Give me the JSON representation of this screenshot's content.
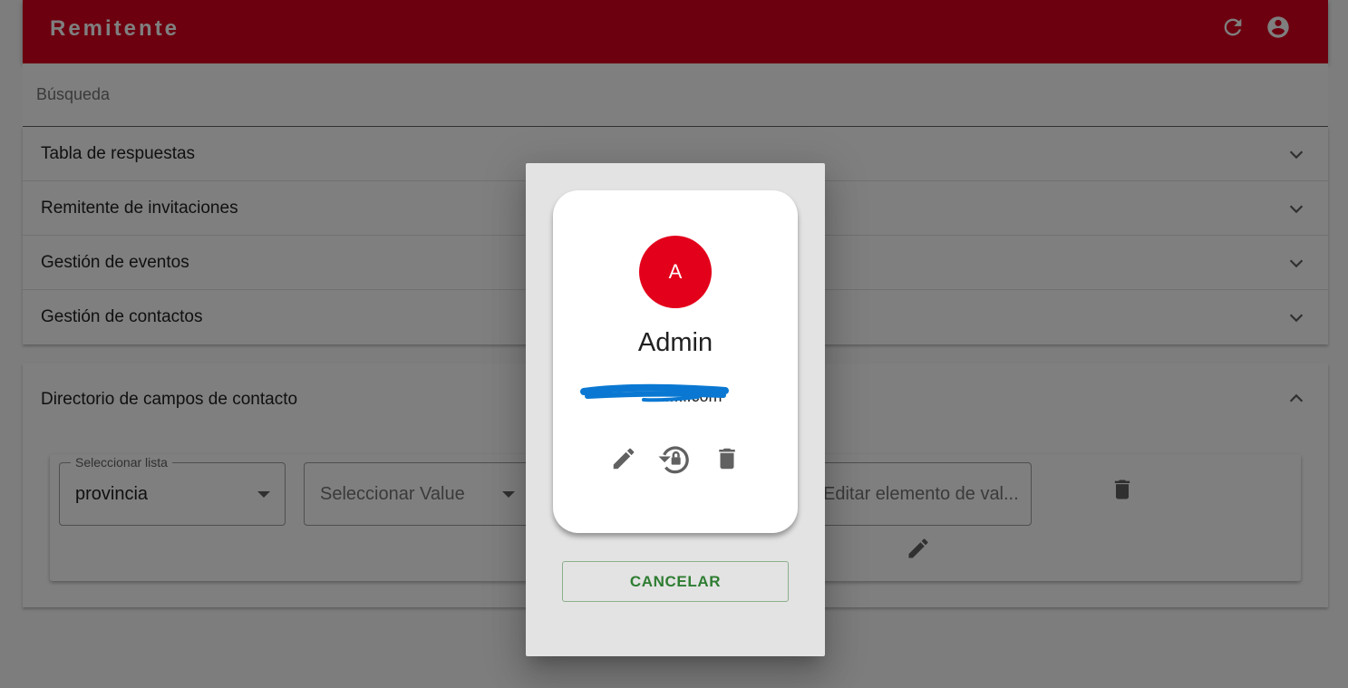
{
  "app": {
    "title": "Remitente"
  },
  "toolbar": {
    "refresh_icon": "refresh-icon",
    "account_icon": "account-circle-icon"
  },
  "search": {
    "placeholder": "Búsqueda",
    "value": ""
  },
  "panels": [
    {
      "title": "Tabla de respuestas",
      "expanded": false
    },
    {
      "title": "Remitente de invitaciones",
      "expanded": false
    },
    {
      "title": "Gestión de eventos",
      "expanded": false
    },
    {
      "title": "Gestión de contactos",
      "expanded": false
    }
  ],
  "directory": {
    "title": "Directorio de campos de contacto",
    "expanded": true,
    "select_list": {
      "label": "Seleccionar lista",
      "value": "provincia"
    },
    "select_value": {
      "placeholder": "Seleccionar Value"
    },
    "edit_value": {
      "placeholder": "Editar elemento de val..."
    }
  },
  "dialog": {
    "avatar_initial": "A",
    "user_name": "Admin",
    "email_visible": "....l.com",
    "actions": [
      "edit-icon",
      "lock-reset-icon",
      "delete-icon"
    ],
    "cancel_label": "CANCELAR"
  },
  "colors": {
    "primary": "#d8001e",
    "avatar": "#e3001b",
    "cancel_text": "#2e7d32",
    "overlay": "rgba(0,0,0,0.5)"
  }
}
